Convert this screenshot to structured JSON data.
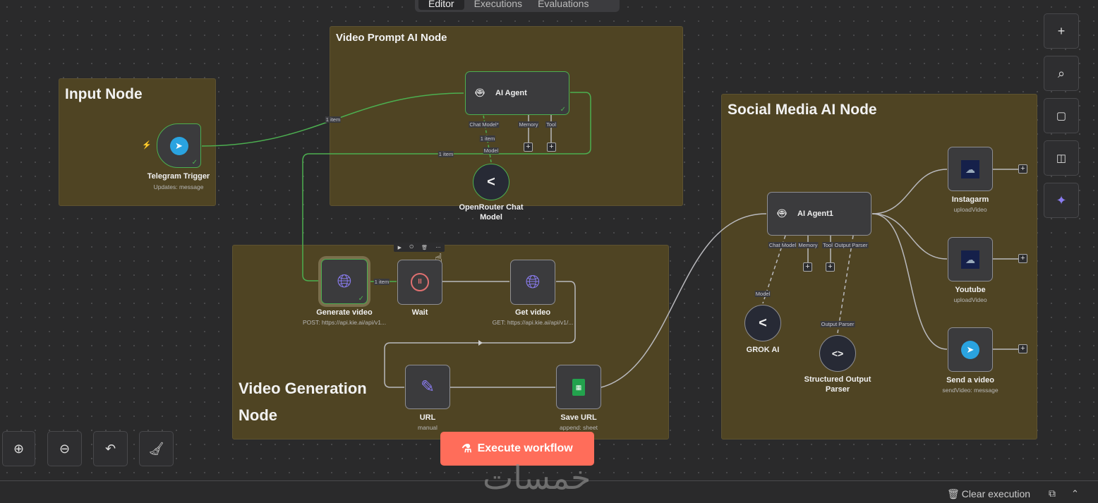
{
  "tabs": [
    {
      "label": "Editor",
      "active": true
    },
    {
      "label": "Executions"
    },
    {
      "label": "Evaluations"
    }
  ],
  "stickies": {
    "input": "Input Node",
    "prompt": "Video Prompt AI Node",
    "generation": "Video Generation Node",
    "social": "Social Media AI Node"
  },
  "nodes": {
    "telegram": {
      "name": "Telegram Trigger",
      "sub": "Updates: message"
    },
    "agent": {
      "name": "AI Agent",
      "handles": [
        "Chat Model*",
        "Memory",
        "Tool"
      ]
    },
    "openrouter": {
      "name": "OpenRouter Chat Model",
      "handle": "Model"
    },
    "generate": {
      "name": "Generate video",
      "sub": "POST: https://api.kie.ai/api/v1..."
    },
    "wait": {
      "name": "Wait"
    },
    "getvideo": {
      "name": "Get video",
      "sub": "GET: https://api.kie.ai/api/v1/..."
    },
    "url": {
      "name": "URL",
      "sub": "manual"
    },
    "saveurl": {
      "name": "Save URL",
      "sub": "append: sheet"
    },
    "agent1": {
      "name": "AI Agent1",
      "handles": [
        "Chat Model",
        "Memory",
        "Tool",
        "Output Parser"
      ]
    },
    "grok": {
      "name": "GROK AI",
      "handle": "Model"
    },
    "parser": {
      "name": "Structured Output Parser",
      "handle": "Output Parser"
    },
    "instagram": {
      "name": "Instagarm",
      "sub": "uploadVideo"
    },
    "youtube": {
      "name": "Youtube",
      "sub": "uploadVideo"
    },
    "sendvideo": {
      "name": "Send a video",
      "sub": "sendVideo: message"
    }
  },
  "edge_labels": {
    "e1": "1 item",
    "e2": "1 item",
    "e3": "1 item",
    "e4": "1 item"
  },
  "execute_label": "Execute workflow",
  "clear_label": "Clear execution",
  "watermark": "خمسات",
  "colors": {
    "accent": "#ff6d5a",
    "success": "#4caf50",
    "sticky": "#4f4423"
  }
}
